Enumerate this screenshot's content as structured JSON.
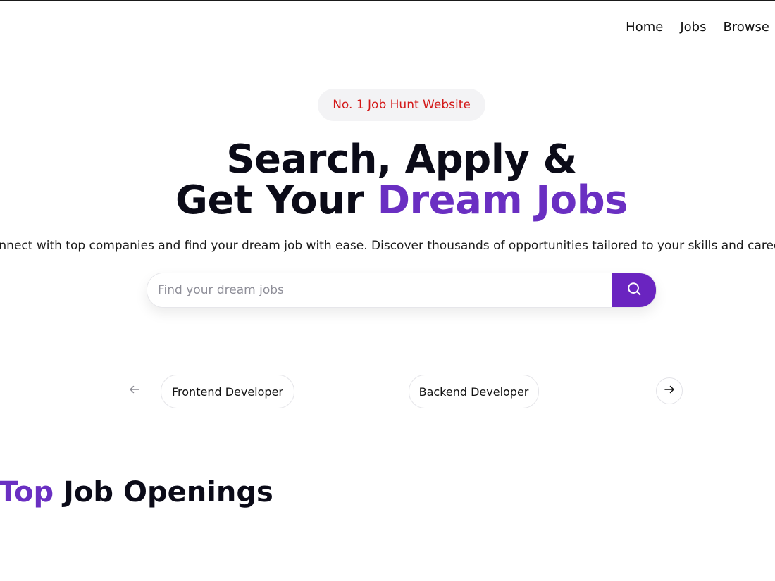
{
  "nav": {
    "items": [
      "Home",
      "Jobs",
      "Browse"
    ]
  },
  "hero": {
    "badge": "No. 1 Job Hunt Website",
    "title_line1": "Search, Apply &",
    "title_line2_prefix": "Get Your ",
    "title_line2_accent": "Dream Jobs",
    "subtitle": "onnect with top companies and find your dream job with ease. Discover thousands of opportunities tailored to your skills and career"
  },
  "search": {
    "placeholder": "Find your dream jobs",
    "value": "",
    "button_icon": "search-icon"
  },
  "categories": {
    "prev_icon": "arrow-left-icon",
    "next_icon": "arrow-right-icon",
    "items": [
      "Frontend Developer",
      "Backend Developer"
    ]
  },
  "section": {
    "title_accent": "Top",
    "title_rest": " Job Openings"
  },
  "colors": {
    "accent": "#6a2fc2",
    "button": "#6a24c0",
    "badge_text": "#d31818",
    "badge_bg": "#f3f3f5"
  }
}
